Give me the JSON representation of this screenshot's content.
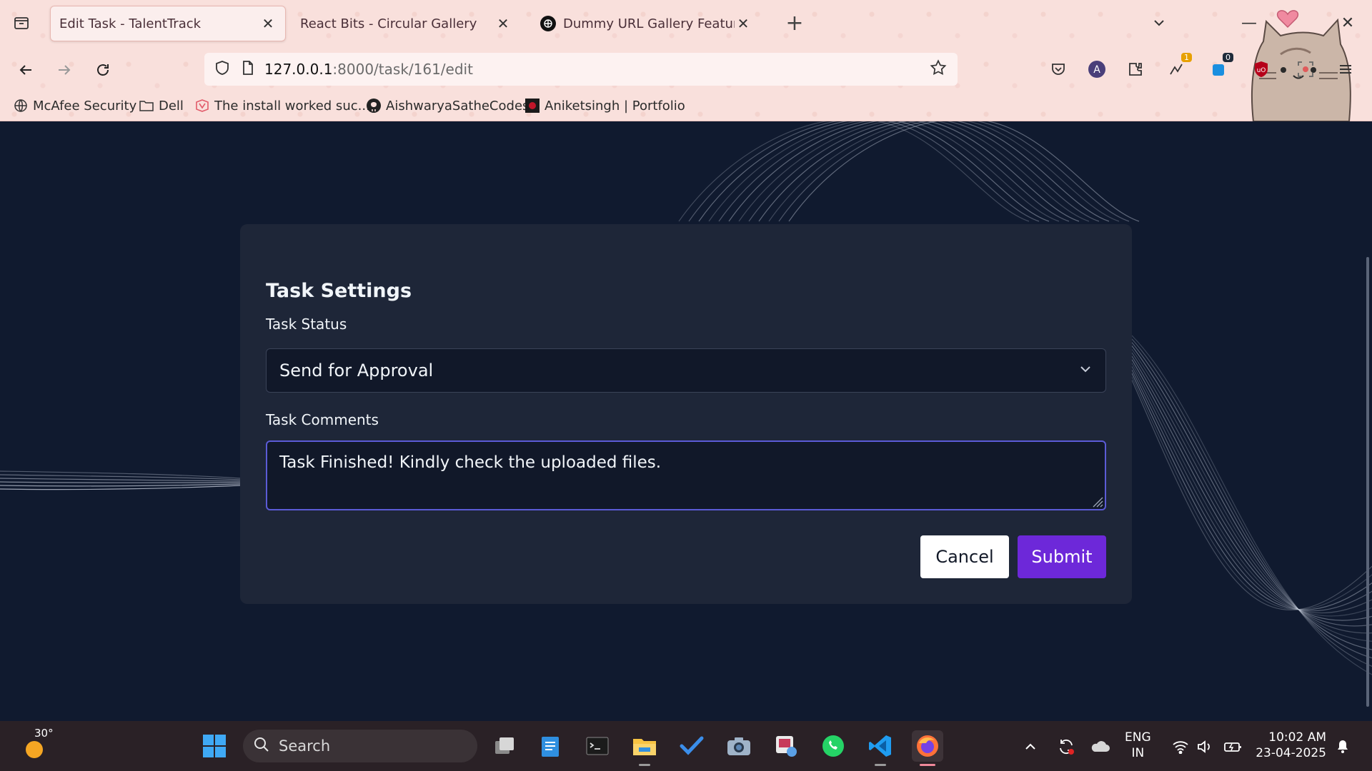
{
  "browser": {
    "tabs": [
      {
        "title": "Edit Task - TalentTrack",
        "active": true
      },
      {
        "title": "React Bits - Circular Gallery",
        "active": false
      },
      {
        "title": "Dummy URL Gallery Features",
        "active": false
      }
    ],
    "url": {
      "host": "127.0.0.1",
      "path": ":8000/task/161/edit"
    },
    "extension_badges": {
      "reader": "1",
      "counter": "0"
    },
    "bookmarks": [
      {
        "label": "McAfee Security",
        "icon": "globe-icon"
      },
      {
        "label": "Dell",
        "icon": "folder-icon"
      },
      {
        "label": "The install worked suc...",
        "icon": "django-icon"
      },
      {
        "label": "AishwaryaSatheCodes",
        "icon": "github-icon"
      },
      {
        "label": "Aniketsingh | Portfolio",
        "icon": "portfolio-icon"
      }
    ],
    "theme_color": "#f9e0dc"
  },
  "card": {
    "title": "Task Settings",
    "status_label": "Task Status",
    "status_value": "Send for Approval",
    "comments_label": "Task Comments",
    "comments_value": "Task Finished! Kindly check the uploaded files.",
    "cancel_label": "Cancel",
    "submit_label": "Submit",
    "accent_color": "#6d28d9",
    "focus_color": "#5b5bd6"
  },
  "taskbar": {
    "weather_temp": "30°",
    "search_placeholder": "Search",
    "language_line1": "ENG",
    "language_line2": "IN",
    "time": "10:02 AM",
    "date": "23-04-2025"
  }
}
